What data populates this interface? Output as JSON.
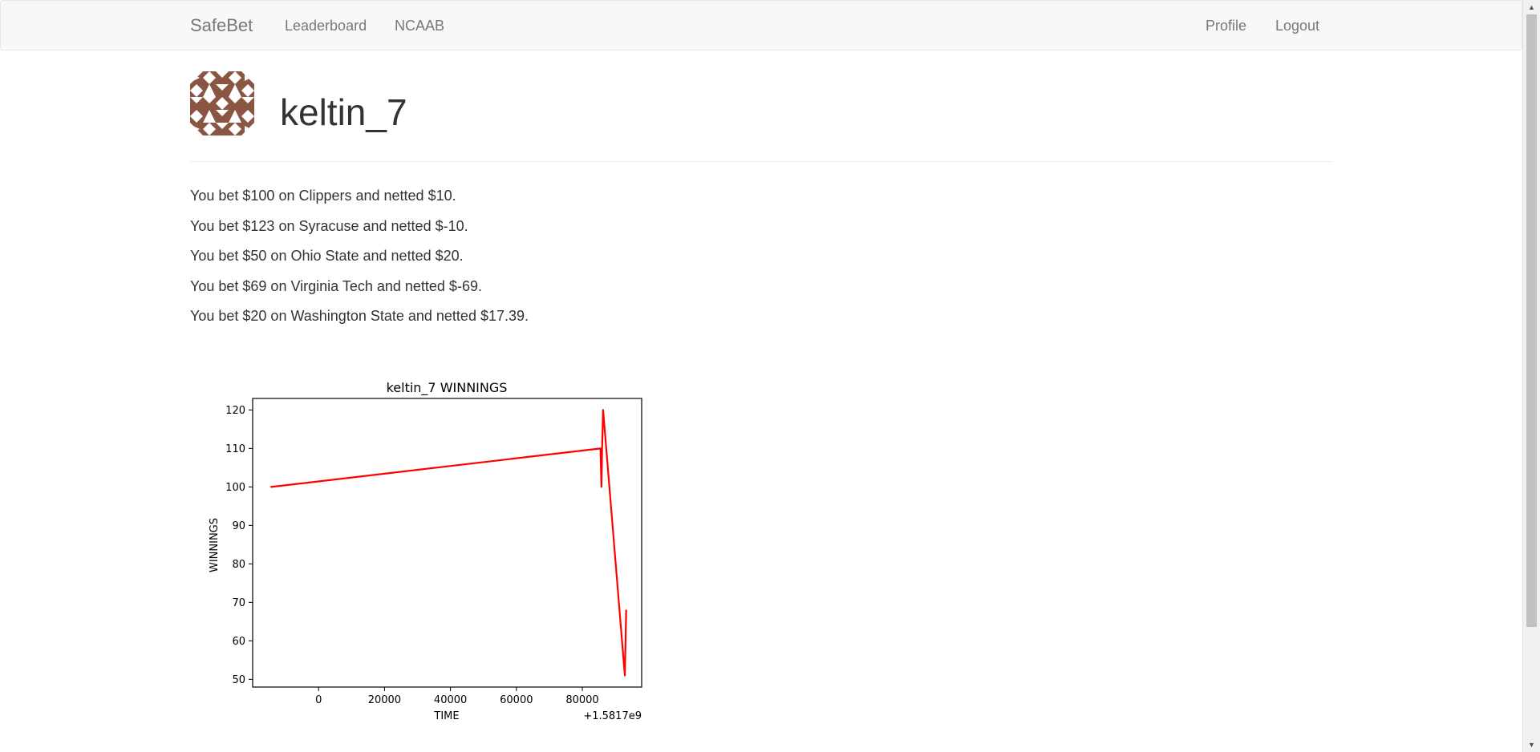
{
  "navbar": {
    "brand": "SafeBet",
    "links": [
      "Leaderboard",
      "NCAAB"
    ],
    "right_links": [
      "Profile",
      "Logout"
    ]
  },
  "profile": {
    "username": "keltin_7",
    "avatar_icon": "identicon-avatar-icon",
    "avatar_color": "#8b5543"
  },
  "bets": [
    "You bet $100 on Clippers and netted $10.",
    "You bet $123 on Syracuse and netted $-10.",
    "You bet $50 on Ohio State and netted $20.",
    "You bet $69 on Virginia Tech and netted $-69.",
    "You bet $20 on Washington State and netted $17.39."
  ],
  "chart_data": {
    "type": "line",
    "title": "keltin_7 WINNINGS",
    "xlabel": "TIME",
    "ylabel": "WINNINGS",
    "offset_label": "+1.5817e9",
    "xlim": [
      -20000,
      98000
    ],
    "ylim": [
      48,
      123
    ],
    "xticks": [
      0,
      20000,
      40000,
      60000,
      80000
    ],
    "yticks": [
      50,
      60,
      70,
      80,
      90,
      100,
      110,
      120
    ],
    "grid": false,
    "line_color": "#ff0000",
    "series": [
      {
        "x": [
          -14500,
          85500,
          85800,
          86000,
          86300,
          92900,
          93300
        ],
        "y": [
          100,
          110,
          100,
          110,
          120,
          51,
          68
        ]
      }
    ]
  }
}
